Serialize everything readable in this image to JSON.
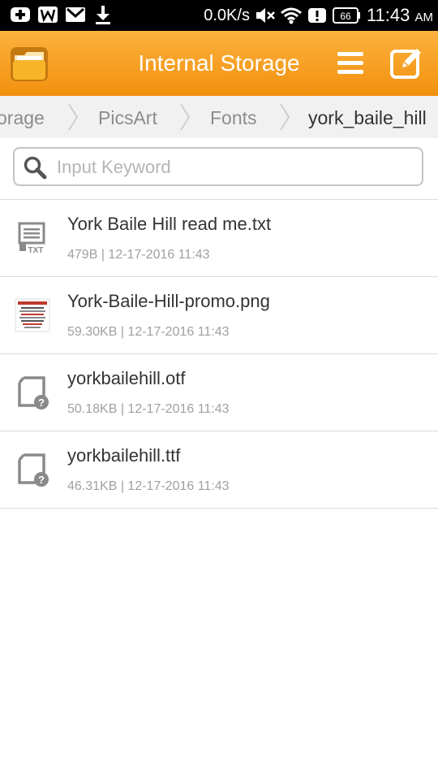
{
  "status_bar": {
    "net_speed": "0.0K/s",
    "battery": "66",
    "time": "11:43",
    "ampm": "AM",
    "icons": [
      "add-notification-icon",
      "w-app-icon",
      "gmail-icon",
      "download-icon",
      "mute-icon",
      "wifi-icon",
      "alert-icon",
      "battery-icon"
    ]
  },
  "header": {
    "title": "Internal Storage",
    "accent": "#f7a024",
    "icons": [
      "file-manager-logo-icon",
      "menu-icon",
      "edit-icon"
    ]
  },
  "breadcrumb": [
    "orage",
    "PicsArt",
    "Fonts",
    "york_baile_hill"
  ],
  "search": {
    "placeholder": "Input Keyword",
    "value": ""
  },
  "files": [
    {
      "name": "York Baile Hill read me.txt",
      "meta": "479B | 12-17-2016 11:43",
      "icon": "txt-file-icon"
    },
    {
      "name": "York-Baile-Hill-promo.png",
      "meta": "59.30KB | 12-17-2016 11:43",
      "icon": "image-thumbnail-icon"
    },
    {
      "name": "yorkbailehill.otf",
      "meta": "50.18KB | 12-17-2016 11:43",
      "icon": "unknown-file-icon"
    },
    {
      "name": "yorkbailehill.ttf",
      "meta": "46.31KB | 12-17-2016 11:43",
      "icon": "unknown-file-icon"
    }
  ]
}
